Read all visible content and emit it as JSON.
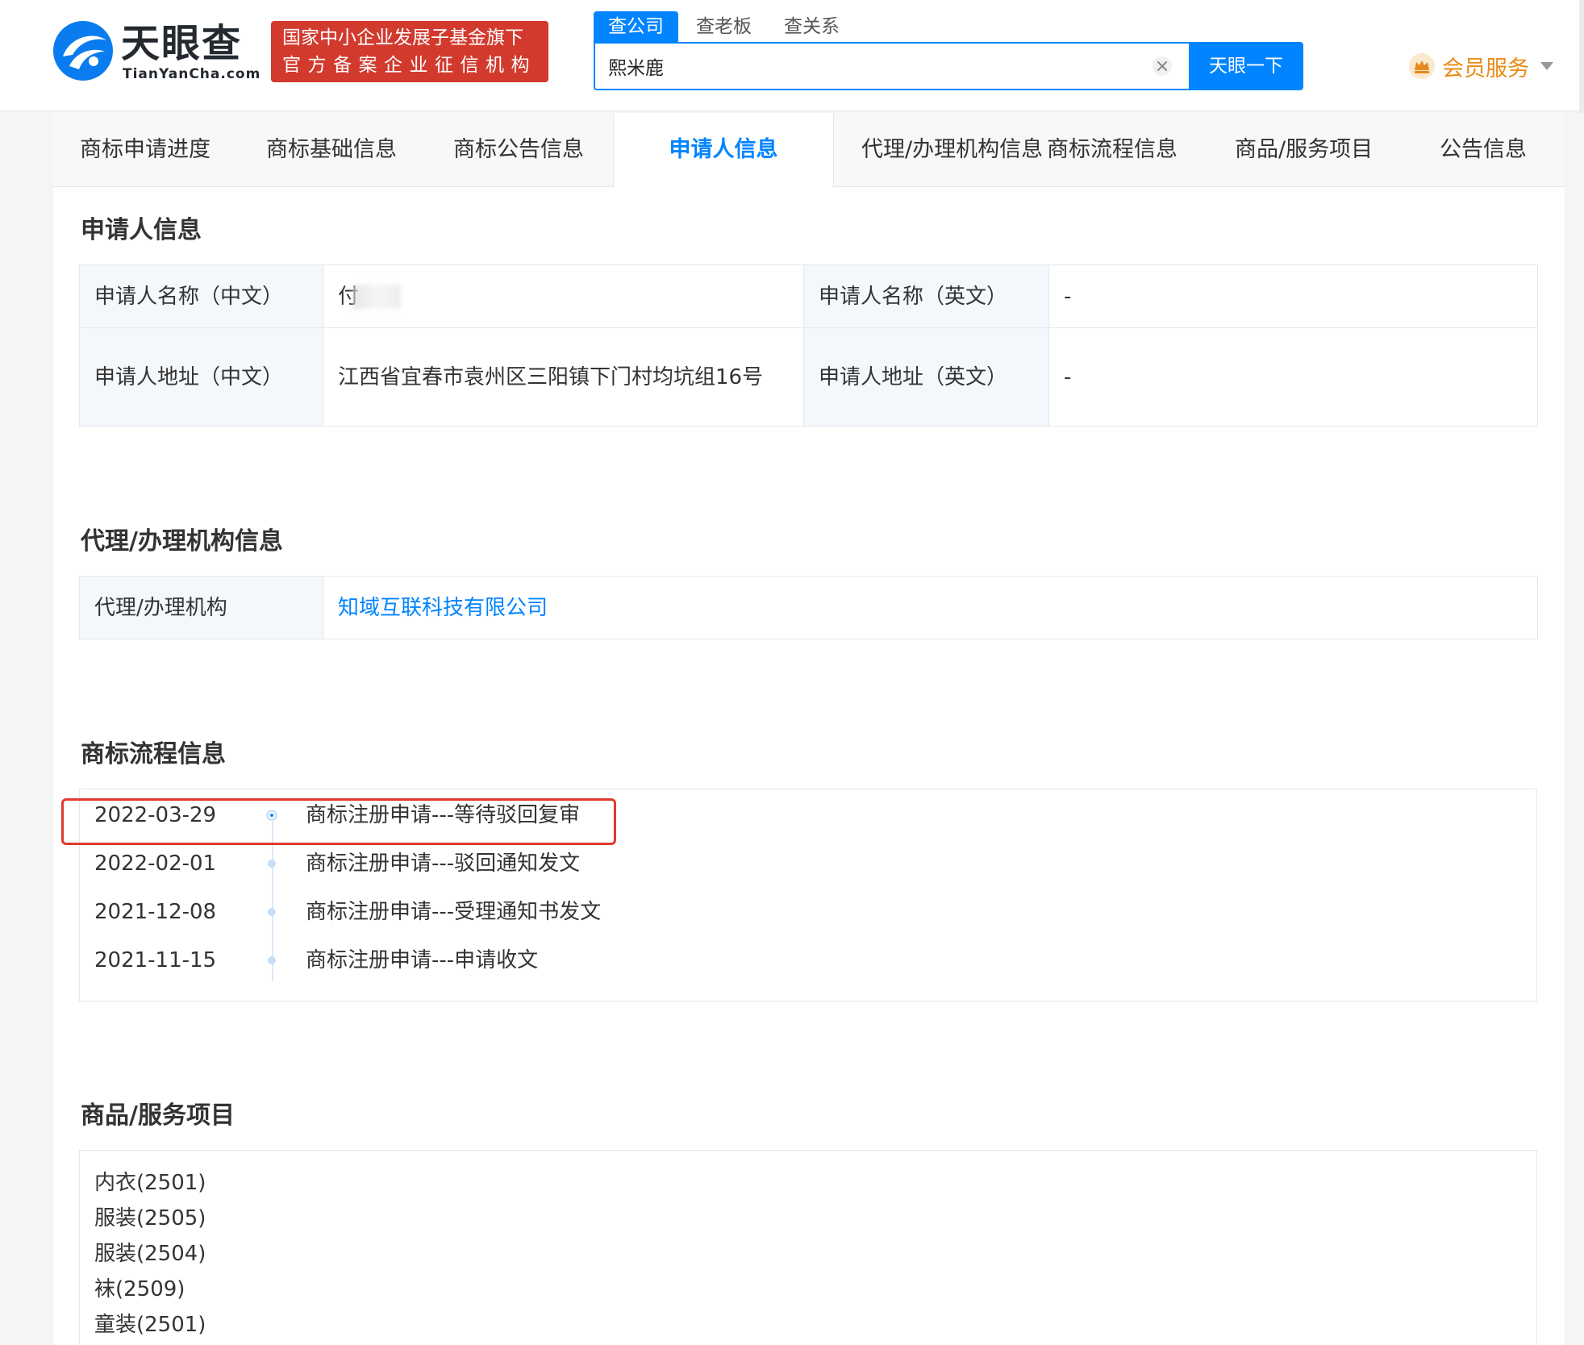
{
  "header": {
    "logo_cn": "天眼查",
    "logo_en": "TianYanCha.com",
    "badge_line1": "国家中小企业发展子基金旗下",
    "badge_line2": "官方备案企业征信机构",
    "search_tabs": [
      "查公司",
      "查老板",
      "查关系"
    ],
    "search_value": "熙米鹿",
    "search_button": "天眼一下",
    "member_label": "会员服务",
    "brand_color": "#0084ff",
    "member_color": "#ea8a15",
    "badge_color": "#d23a2e"
  },
  "nav": {
    "items": [
      "商标申请进度",
      "商标基础信息",
      "商标公告信息",
      "申请人信息",
      "代理/办理机构信息",
      "商标流程信息",
      "商品/服务项目",
      "公告信息"
    ],
    "active": "申请人信息"
  },
  "applicant": {
    "title": "申请人信息",
    "name_cn_label": "申请人名称（中文）",
    "name_cn_value": "付",
    "name_en_label": "申请人名称（英文）",
    "name_en_value": "-",
    "addr_cn_label": "申请人地址（中文）",
    "addr_cn_value": "江西省宜春市袁州区三阳镇下门村均坑组16号",
    "addr_en_label": "申请人地址（英文）",
    "addr_en_value": "-"
  },
  "agency": {
    "title": "代理/办理机构信息",
    "label": "代理/办理机构",
    "value": "知域互联科技有限公司"
  },
  "flow": {
    "title": "商标流程信息",
    "items": [
      {
        "date": "2022-03-29",
        "text": "商标注册申请---等待驳回复审"
      },
      {
        "date": "2022-02-01",
        "text": "商标注册申请---驳回通知发文"
      },
      {
        "date": "2021-12-08",
        "text": "商标注册申请---受理通知书发文"
      },
      {
        "date": "2021-11-15",
        "text": "商标注册申请---申请收文"
      }
    ],
    "highlight_color": "#e03a2e"
  },
  "goods": {
    "title": "商品/服务项目",
    "items": [
      "内衣(2501)",
      "服装(2505)",
      "服装(2504)",
      "袜(2509)",
      "童装(2501)"
    ]
  }
}
